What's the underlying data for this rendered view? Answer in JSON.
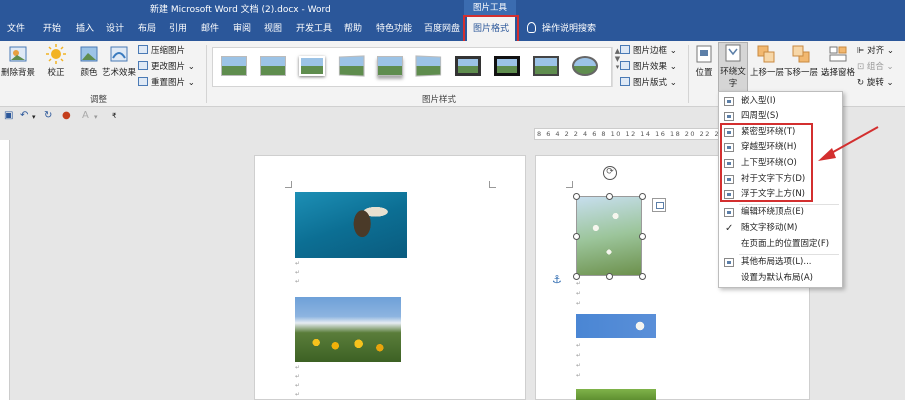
{
  "titlebar": {
    "title": "新建 Microsoft Word 文档 (2).docx  -  Word",
    "context_tab_group": "图片工具"
  },
  "tabs": [
    {
      "label": "文件"
    },
    {
      "label": "开始"
    },
    {
      "label": "插入"
    },
    {
      "label": "设计"
    },
    {
      "label": "布局"
    },
    {
      "label": "引用"
    },
    {
      "label": "邮件"
    },
    {
      "label": "审阅"
    },
    {
      "label": "视图"
    },
    {
      "label": "开发工具"
    },
    {
      "label": "帮助"
    },
    {
      "label": "特色功能"
    },
    {
      "label": "百度网盘"
    },
    {
      "label": "图片格式",
      "active": true
    },
    {
      "label": "操作说明搜索"
    }
  ],
  "ribbon": {
    "adjust": {
      "remove_bg": "删除背景",
      "correct": "校正",
      "color": "颜色",
      "artistic": "艺术效果",
      "compress": "压缩图片",
      "change": "更改图片",
      "reset": "重置图片",
      "group_label": "调整"
    },
    "styles": {
      "group_label": "图片样式",
      "border": "图片边框",
      "effects": "图片效果",
      "layout": "图片版式"
    },
    "arrange": {
      "position": "位置",
      "wrap_text_line1": "环绕文",
      "wrap_text_line2": "字",
      "bring_forward": "上移一层",
      "send_backward": "下移一层",
      "selection_pane": "选择窗格",
      "align": "对齐",
      "group": "组合",
      "rotate": "旋转"
    }
  },
  "ruler": {
    "ticks": "8 6 4 2  2 4 6 8 10 12 14 16 18 20 22 24 26 28"
  },
  "wrap_menu": {
    "items": [
      {
        "label": "嵌入型(I)",
        "icon": "inline-icon"
      },
      {
        "label": "四周型(S)",
        "icon": "square-icon"
      },
      {
        "label": "紧密型环绕(T)",
        "icon": "tight-icon"
      },
      {
        "label": "穿越型环绕(H)",
        "icon": "through-icon"
      },
      {
        "label": "上下型环绕(O)",
        "icon": "top-bottom-icon"
      },
      {
        "label": "衬于文字下方(D)",
        "icon": "behind-text-icon"
      },
      {
        "label": "浮于文字上方(N)",
        "icon": "in-front-icon"
      },
      {
        "label": "编辑环绕顶点(E)",
        "icon": "edit-points-icon"
      },
      {
        "label": "随文字移动(M)",
        "icon": "checkmark-icon",
        "checked": true
      },
      {
        "label": "在页面上的位置固定(F)",
        "icon": ""
      },
      {
        "label": "其他布局选项(L)...",
        "icon": "more-layout-icon"
      },
      {
        "label": "设置为默认布局(A)",
        "icon": ""
      }
    ]
  },
  "colors": {
    "titlebar": "#2b579a",
    "highlight": "#d32f2f"
  }
}
